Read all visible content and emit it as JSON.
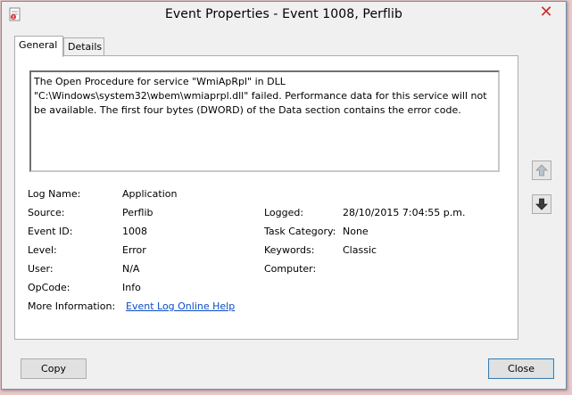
{
  "window": {
    "title": "Event Properties - Event 1008, Perflib",
    "close_glyph": "✕"
  },
  "tabs": [
    {
      "label": "General",
      "active": true
    },
    {
      "label": "Details",
      "active": false
    }
  ],
  "description": "The Open Procedure for service \"WmiApRpl\" in DLL \"C:\\Windows\\system32\\wbem\\wmiaprpl.dll\" failed. Performance data for this service will not be available. The first four bytes (DWORD) of the Data section contains the error code.",
  "fields": {
    "log_name": {
      "label": "Log Name:",
      "value": "Application"
    },
    "source": {
      "label": "Source:",
      "value": "Perflib"
    },
    "event_id": {
      "label": "Event ID:",
      "value": "1008"
    },
    "level": {
      "label": "Level:",
      "value": "Error"
    },
    "user": {
      "label": "User:",
      "value": "N/A"
    },
    "opcode": {
      "label": "OpCode:",
      "value": "Info"
    },
    "more_info": {
      "label": "More Information:",
      "value": "Event Log Online Help"
    },
    "logged": {
      "label": "Logged:",
      "value": "28/10/2015 7:04:55 p.m."
    },
    "task_category": {
      "label": "Task Category:",
      "value": "None"
    },
    "keywords": {
      "label": "Keywords:",
      "value": "Classic"
    },
    "computer": {
      "label": "Computer:",
      "value": ""
    }
  },
  "buttons": {
    "copy": "Copy",
    "close": "Close"
  },
  "icons": {
    "up": "up-arrow-icon",
    "down": "down-arrow-icon",
    "app": "event-log-icon"
  },
  "colors": {
    "link": "#0a4cc6",
    "close_x": "#c9302c",
    "down_arrow": "#2f6b1f"
  }
}
